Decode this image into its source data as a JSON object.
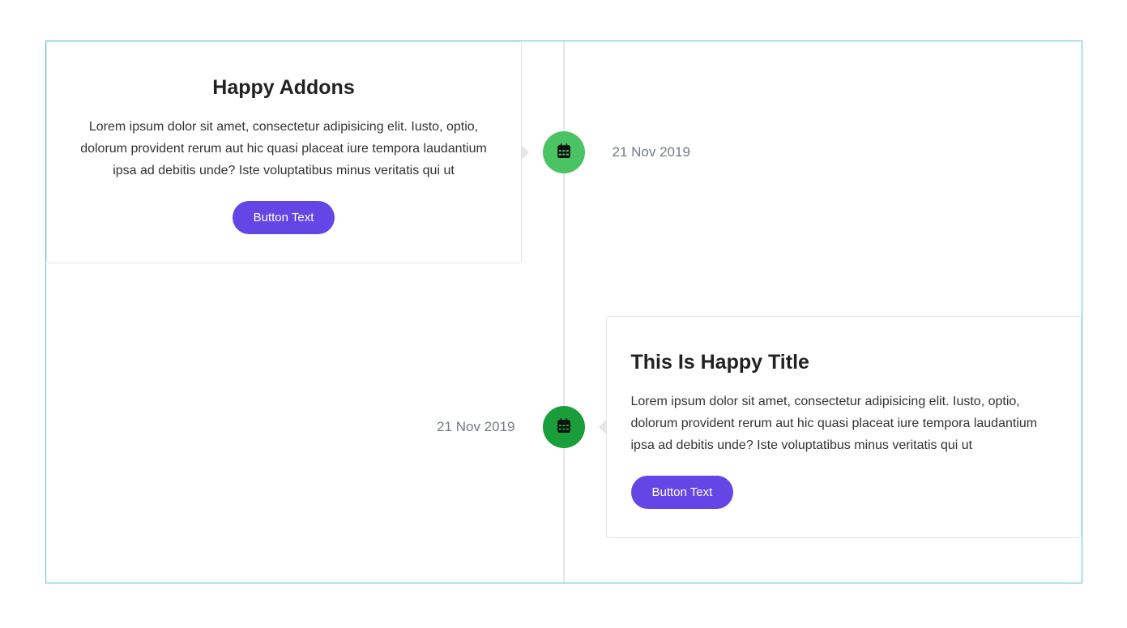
{
  "timeline": {
    "items": [
      {
        "title": "Happy Addons",
        "description": "Lorem ipsum dolor sit amet, consectetur adipisicing elit. Iusto, optio, dolorum provident rerum aut hic quasi placeat iure tempora laudantium ipsa ad debitis unde? Iste voluptatibus minus veritatis qui ut",
        "button_label": "Button Text",
        "date": "21 Nov 2019"
      },
      {
        "title": "This Is Happy Title",
        "description": "Lorem ipsum dolor sit amet, consectetur adipisicing elit. Iusto, optio, dolorum provident rerum aut hic quasi placeat iure tempora laudantium ipsa ad debitis unde? Iste voluptatibus minus veritatis qui ut",
        "button_label": "Button Text",
        "date": "21 Nov 2019"
      }
    ]
  },
  "icons": {
    "calendar": "calendar-icon"
  },
  "colors": {
    "accent_button": "#6446e6",
    "node_light": "#4ac463",
    "node_dark": "#1a9e3c",
    "border_outer": "#5bc0de"
  }
}
